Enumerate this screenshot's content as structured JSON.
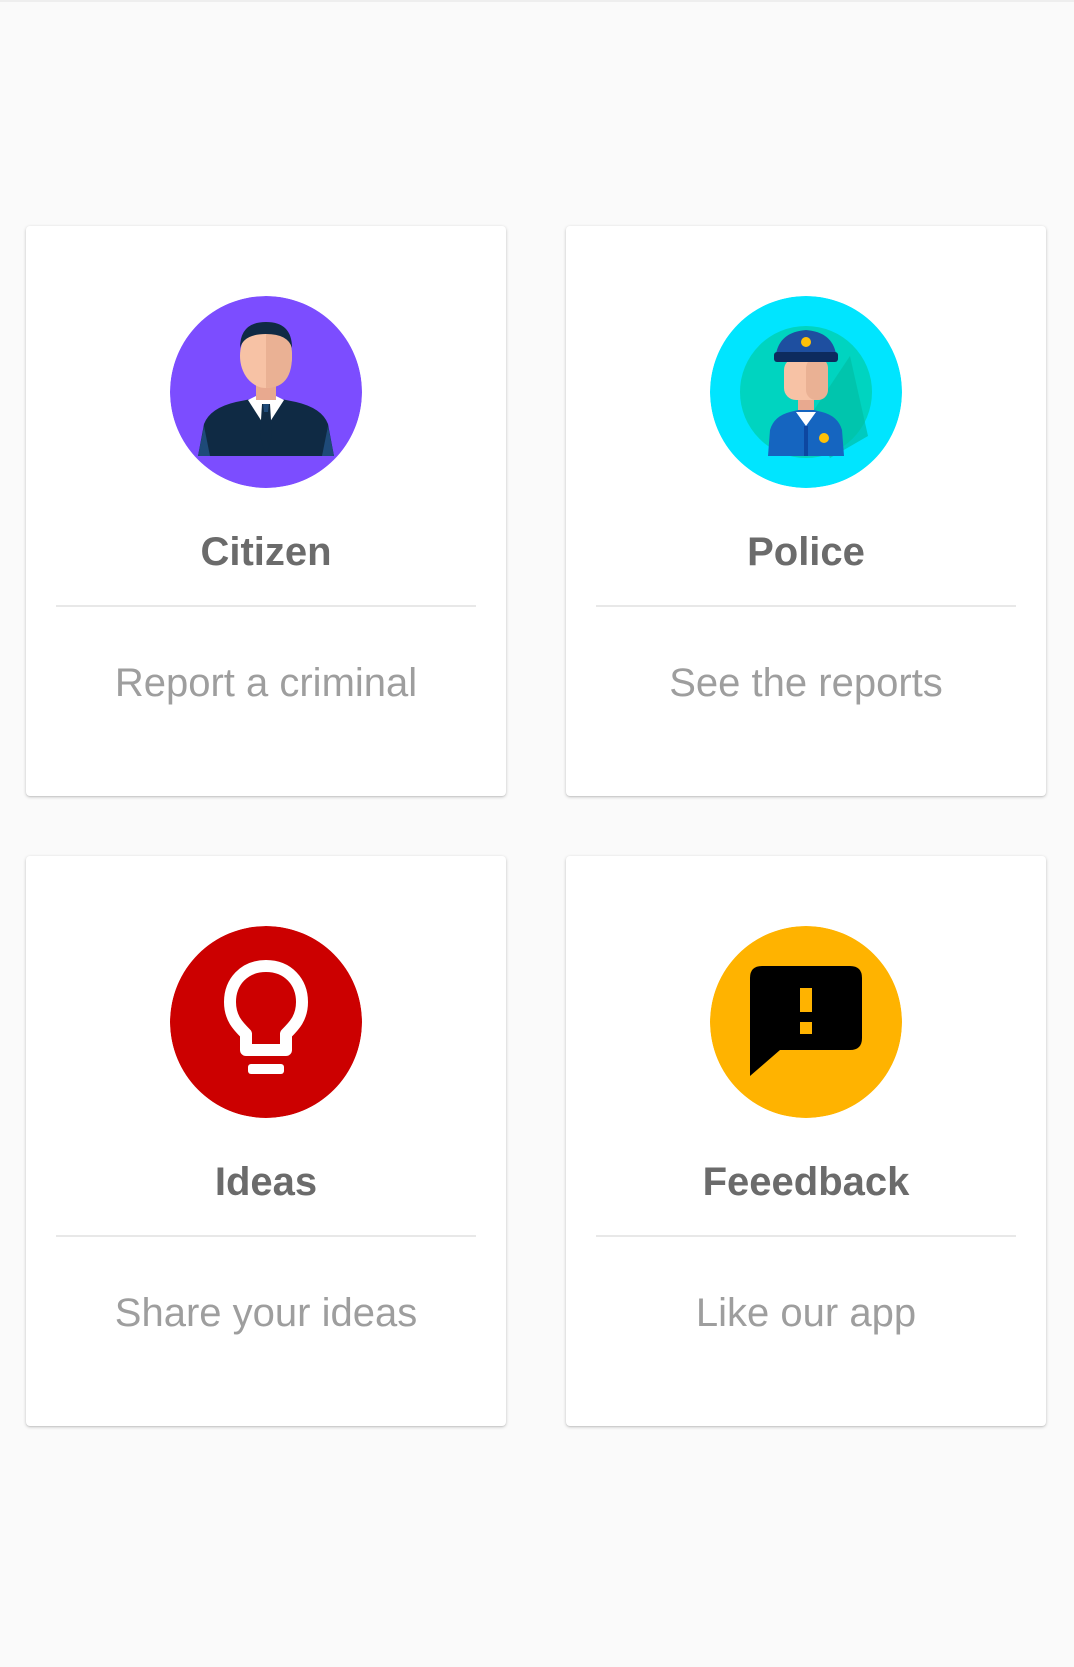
{
  "cards": [
    {
      "title": "Citizen",
      "subtitle": "Report a criminal",
      "icon": "citizen-avatar-icon",
      "color": "#7c4dff"
    },
    {
      "title": "Police",
      "subtitle": "See the reports",
      "icon": "police-officer-icon",
      "color": "#00e5ff"
    },
    {
      "title": "Ideas",
      "subtitle": "Share your ideas",
      "icon": "lightbulb-icon",
      "color": "#cc0000"
    },
    {
      "title": "Feeedback",
      "subtitle": "Like our app",
      "icon": "feedback-alert-icon",
      "color": "#ffb300"
    }
  ]
}
